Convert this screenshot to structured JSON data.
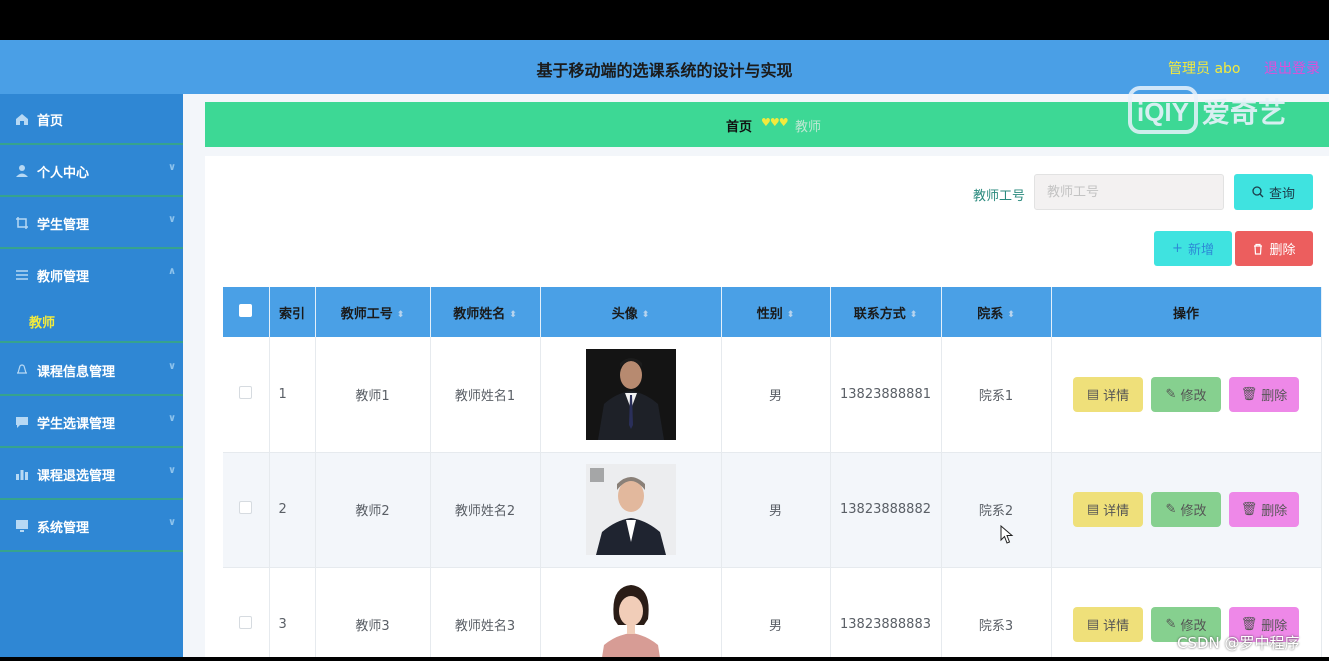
{
  "header": {
    "title": "基于移动端的选课系统的设计与实现",
    "admin": "管理员 abo",
    "logout": "退出登录"
  },
  "sidebar": {
    "items": [
      {
        "label": "首页",
        "icon": "home-icon"
      },
      {
        "label": "个人中心",
        "icon": "user-icon",
        "expandable": true
      },
      {
        "label": "学生管理",
        "icon": "crop-icon",
        "expandable": true
      },
      {
        "label": "教师管理",
        "icon": "menu-icon",
        "expandable": true,
        "expanded": true
      },
      {
        "label": "课程信息管理",
        "icon": "bell-icon",
        "expandable": true
      },
      {
        "label": "学生选课管理",
        "icon": "chat-icon",
        "expandable": true
      },
      {
        "label": "课程退选管理",
        "icon": "bar-chart-icon",
        "expandable": true
      },
      {
        "label": "系统管理",
        "icon": "monitor-icon",
        "expandable": true
      }
    ],
    "subitem": "教师"
  },
  "breadcrumb": {
    "home": "首页",
    "separator": "♥♥♥",
    "current": "教师"
  },
  "watermark": {
    "text": "爱奇艺"
  },
  "search": {
    "label": "教师工号",
    "placeholder": "教师工号",
    "button": "查询"
  },
  "actions": {
    "add": "新增",
    "delete": "删除"
  },
  "table": {
    "columns": [
      "索引",
      "教师工号",
      "教师姓名",
      "头像",
      "性别",
      "联系方式",
      "院系",
      "操作"
    ],
    "rows": [
      {
        "index": "1",
        "id": "教师1",
        "name": "教师姓名1",
        "avatar": "portrait-man-suit",
        "gender": "男",
        "phone": "13823888881",
        "dept": "院系1"
      },
      {
        "index": "2",
        "id": "教师2",
        "name": "教师姓名2",
        "avatar": "portrait-man-smiling",
        "gender": "男",
        "phone": "13823888882",
        "dept": "院系2"
      },
      {
        "index": "3",
        "id": "教师3",
        "name": "教师姓名3",
        "avatar": "portrait-woman",
        "gender": "男",
        "phone": "13823888883",
        "dept": "院系3"
      }
    ],
    "row_actions": {
      "detail": "详情",
      "edit": "修改",
      "delete": "删除"
    }
  },
  "footer_watermark": "CSDN @罗中程序",
  "colors": {
    "topbar": "#4a9fe6",
    "sidebar": "#2f87d4",
    "breadcrumb": "#3dd895",
    "accent_yellow": "#f2ea3d",
    "logout": "#e04fd8"
  }
}
